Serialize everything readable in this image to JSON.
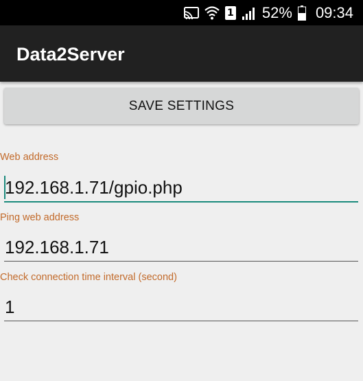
{
  "status_bar": {
    "icons": [
      "cast-icon",
      "wifi-icon",
      "sim-1-icon",
      "cellular-signal-icon",
      "battery-icon"
    ],
    "sim_slot": "1",
    "battery_percent": "52%",
    "time": "09:34"
  },
  "app": {
    "title": "Data2Server"
  },
  "actions": {
    "save_label": "SAVE SETTINGS"
  },
  "fields": [
    {
      "label": "Web address",
      "value": "192.168.1.71/gpio.php",
      "focused": true
    },
    {
      "label": "Ping web address",
      "value": "192.168.1.71",
      "focused": false
    },
    {
      "label": "Check connection time interval (second)",
      "value": "1",
      "focused": false
    }
  ],
  "colors": {
    "accent": "#1a8a7c",
    "label": "#c26a2a",
    "action_bar": "#212121",
    "background": "#efefef"
  }
}
